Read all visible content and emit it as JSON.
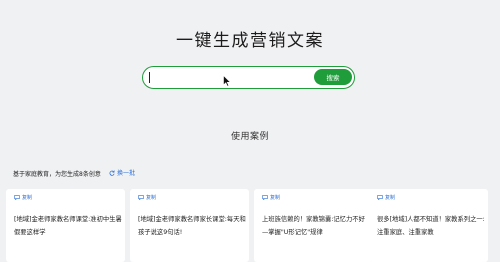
{
  "hero": {
    "title": "一键生成营销文案"
  },
  "search": {
    "value": "",
    "button_label": "搜索"
  },
  "examples": {
    "section_title": "使用案例",
    "subheading": "基于家庭教育，为您生成8条创意",
    "refresh_label": "换一批",
    "cards": [
      {
        "tag": "复制",
        "text": "[地域]金老师家教名师课堂:准初中生暑假要这样学"
      },
      {
        "tag": "复制",
        "text": "[地域]金老师家教名师家长课堂:每天和孩子说这9句话!"
      },
      {
        "tag": "复制",
        "text": "上班族信赖的！家教锦囊:记忆力不好—掌握\"U形记忆\"规律"
      },
      {
        "tag": "复制",
        "text": "很多[地域]人都不知道！家教系列之一:注重家庭、注重家教"
      }
    ]
  },
  "colors": {
    "accent": "#1f9d3a",
    "link": "#2b6fd6",
    "background": "#f0f1f3"
  },
  "icons": {
    "cursor": "mouse-pointer-icon",
    "refresh": "refresh-icon",
    "copy": "copy-icon"
  }
}
